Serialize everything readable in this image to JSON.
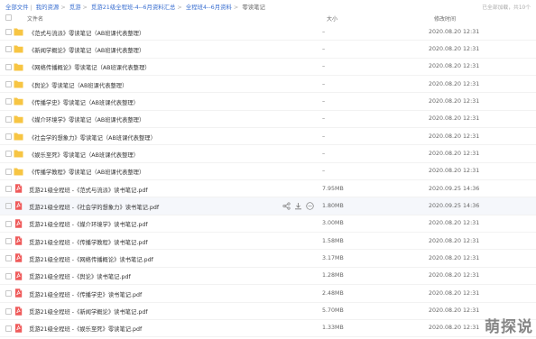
{
  "breadcrumb": {
    "items": [
      "全部文件",
      "我的资源",
      "觅游",
      "觅游21级全程班-4--6月资料汇总",
      "全程班4--6月资料",
      "零读笔记"
    ],
    "right_text": "已全部加载，共10个"
  },
  "header": {
    "name": "文件名",
    "size": "大小",
    "time": "修改时间"
  },
  "files": [
    {
      "type": "folder",
      "name": "《范式与流派》零读笔记（AB班课代表整理）",
      "size": "–",
      "time": "2020.08.20 12:31"
    },
    {
      "type": "folder",
      "name": "《新闻学概论》零读笔记（AB班课代表整理）",
      "size": "–",
      "time": "2020.08.20 12:31"
    },
    {
      "type": "folder",
      "name": "《网络传播概论》零读笔记（AB班课代表整理）",
      "size": "–",
      "time": "2020.08.20 12:31"
    },
    {
      "type": "folder",
      "name": "《舆论》零读笔记（AB班课代表整理）",
      "size": "–",
      "time": "2020.08.20 12:31"
    },
    {
      "type": "folder",
      "name": "《传播学史》零读笔记（AB班课代表整理）",
      "size": "–",
      "time": "2020.08.20 12:31"
    },
    {
      "type": "folder",
      "name": "《媒介环境学》零读笔记（AB班课代表整理）",
      "size": "–",
      "time": "2020.08.20 12:31"
    },
    {
      "type": "folder",
      "name": "《社会学的想象力》零读笔记（AB班课代表整理）",
      "size": "–",
      "time": "2020.08.20 12:31"
    },
    {
      "type": "folder",
      "name": "《娱乐至死》零读笔记（AB班课代表整理）",
      "size": "–",
      "time": "2020.08.20 12:31"
    },
    {
      "type": "folder",
      "name": "《传播学教程》零读笔记（AB班课代表整理）",
      "size": "–",
      "time": "2020.08.20 12:31"
    },
    {
      "type": "pdf",
      "name": "觅游21级全程班 -《范式与流派》读书笔记.pdf",
      "size": "7.95MB",
      "time": "2020.09.25 14:36"
    },
    {
      "type": "pdf",
      "name": "觅游21级全程班 -《社会学的想象力》读书笔记.pdf",
      "size": "1.80MB",
      "time": "2020.09.25 14:36"
    },
    {
      "type": "pdf",
      "name": "觅游21级全程班 -《媒介环境学》读书笔记.pdf",
      "size": "3.00MB",
      "time": "2020.08.20 12:31"
    },
    {
      "type": "pdf",
      "name": "觅游21级全程班 -《传播学教程》读书笔记.pdf",
      "size": "1.58MB",
      "time": "2020.08.20 12:31"
    },
    {
      "type": "pdf",
      "name": "觅游21级全程班 -《网络传播概论》读书笔记.pdf",
      "size": "3.17MB",
      "time": "2020.08.20 12:31"
    },
    {
      "type": "pdf",
      "name": "觅游21级全程班 -《舆论》读书笔记.pdf",
      "size": "1.28MB",
      "time": "2020.08.20 12:31"
    },
    {
      "type": "pdf",
      "name": "觅游21级全程班 -《传播学史》读书笔记.pdf",
      "size": "2.48MB",
      "time": "2020.08.20 12:31"
    },
    {
      "type": "pdf",
      "name": "觅游21级全程班 -《新闻学概论》读书笔记.pdf",
      "size": "5.70MB",
      "time": "2020.08.20 12:31"
    },
    {
      "type": "pdf",
      "name": "觅游21级全程班 -《娱乐至死》零读笔记.pdf",
      "size": "1.33MB",
      "time": "2020.08.20 12:31"
    }
  ],
  "hover_row": 10,
  "row_actions": [
    "share-icon",
    "download-icon",
    "more-icon"
  ],
  "colors": {
    "folder": "#f7c543",
    "pdf": "#ef5b5b",
    "link": "#3a6fd0"
  },
  "watermark": "萌探说"
}
